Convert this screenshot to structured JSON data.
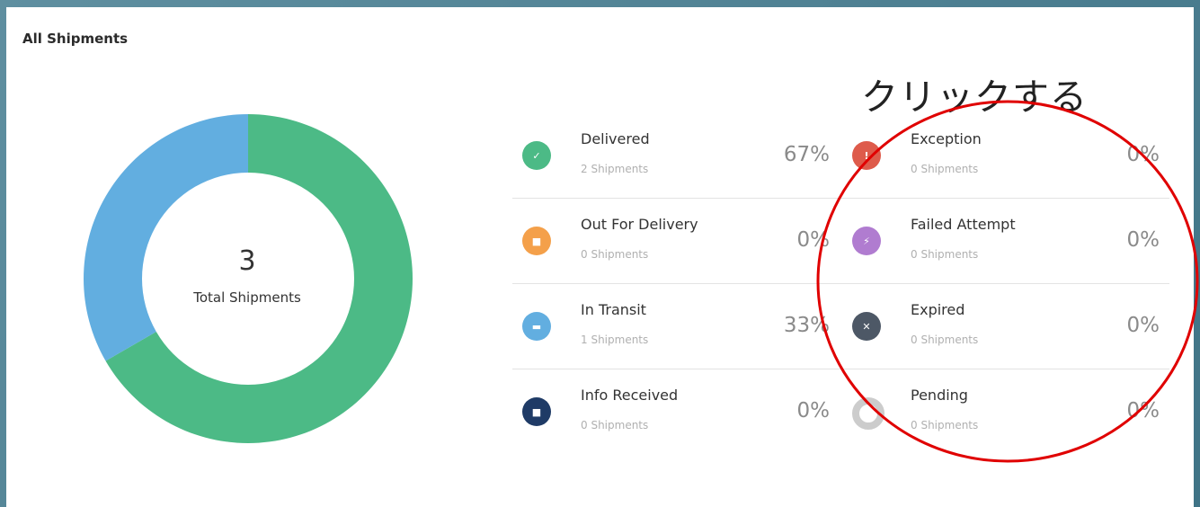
{
  "panel": {
    "title": "All Shipments"
  },
  "annotation": {
    "label": "クリックする",
    "color": "#e00000"
  },
  "chart_data": {
    "type": "pie",
    "style": "donut",
    "categories": [
      "Delivered",
      "In Transit"
    ],
    "values": [
      2,
      1
    ],
    "colors": [
      "#4cba86",
      "#62aee0"
    ],
    "center_value": "3",
    "center_label": "Total Shipments"
  },
  "statuses": [
    {
      "label": "Delivered",
      "count": "2 Shipments",
      "pct": "67%",
      "color": "#4cba86",
      "icon": "check-icon",
      "glyph": "✓"
    },
    {
      "label": "Out For Delivery",
      "count": "0 Shipments",
      "pct": "0%",
      "color": "#f4a04a",
      "icon": "package-icon",
      "glyph": "■"
    },
    {
      "label": "In Transit",
      "count": "1 Shipments",
      "pct": "33%",
      "color": "#62aee0",
      "icon": "truck-icon",
      "glyph": "▬"
    },
    {
      "label": "Info Received",
      "count": "0 Shipments",
      "pct": "0%",
      "color": "#1f3b66",
      "icon": "document-icon",
      "glyph": "■"
    },
    {
      "label": "Exception",
      "count": "0 Shipments",
      "pct": "0%",
      "color": "#de5b4b",
      "icon": "exclamation-icon",
      "glyph": "!"
    },
    {
      "label": "Failed Attempt",
      "count": "0 Shipments",
      "pct": "0%",
      "color": "#b07cd0",
      "icon": "lightning-icon",
      "glyph": "⚡"
    },
    {
      "label": "Expired",
      "count": "0 Shipments",
      "pct": "0%",
      "color": "#4d5866",
      "icon": "x-icon",
      "glyph": "✕"
    },
    {
      "label": "Pending",
      "count": "0 Shipments",
      "pct": "0%",
      "color": "#cccccc",
      "icon": "pending-ring-icon",
      "glyph": ""
    }
  ]
}
